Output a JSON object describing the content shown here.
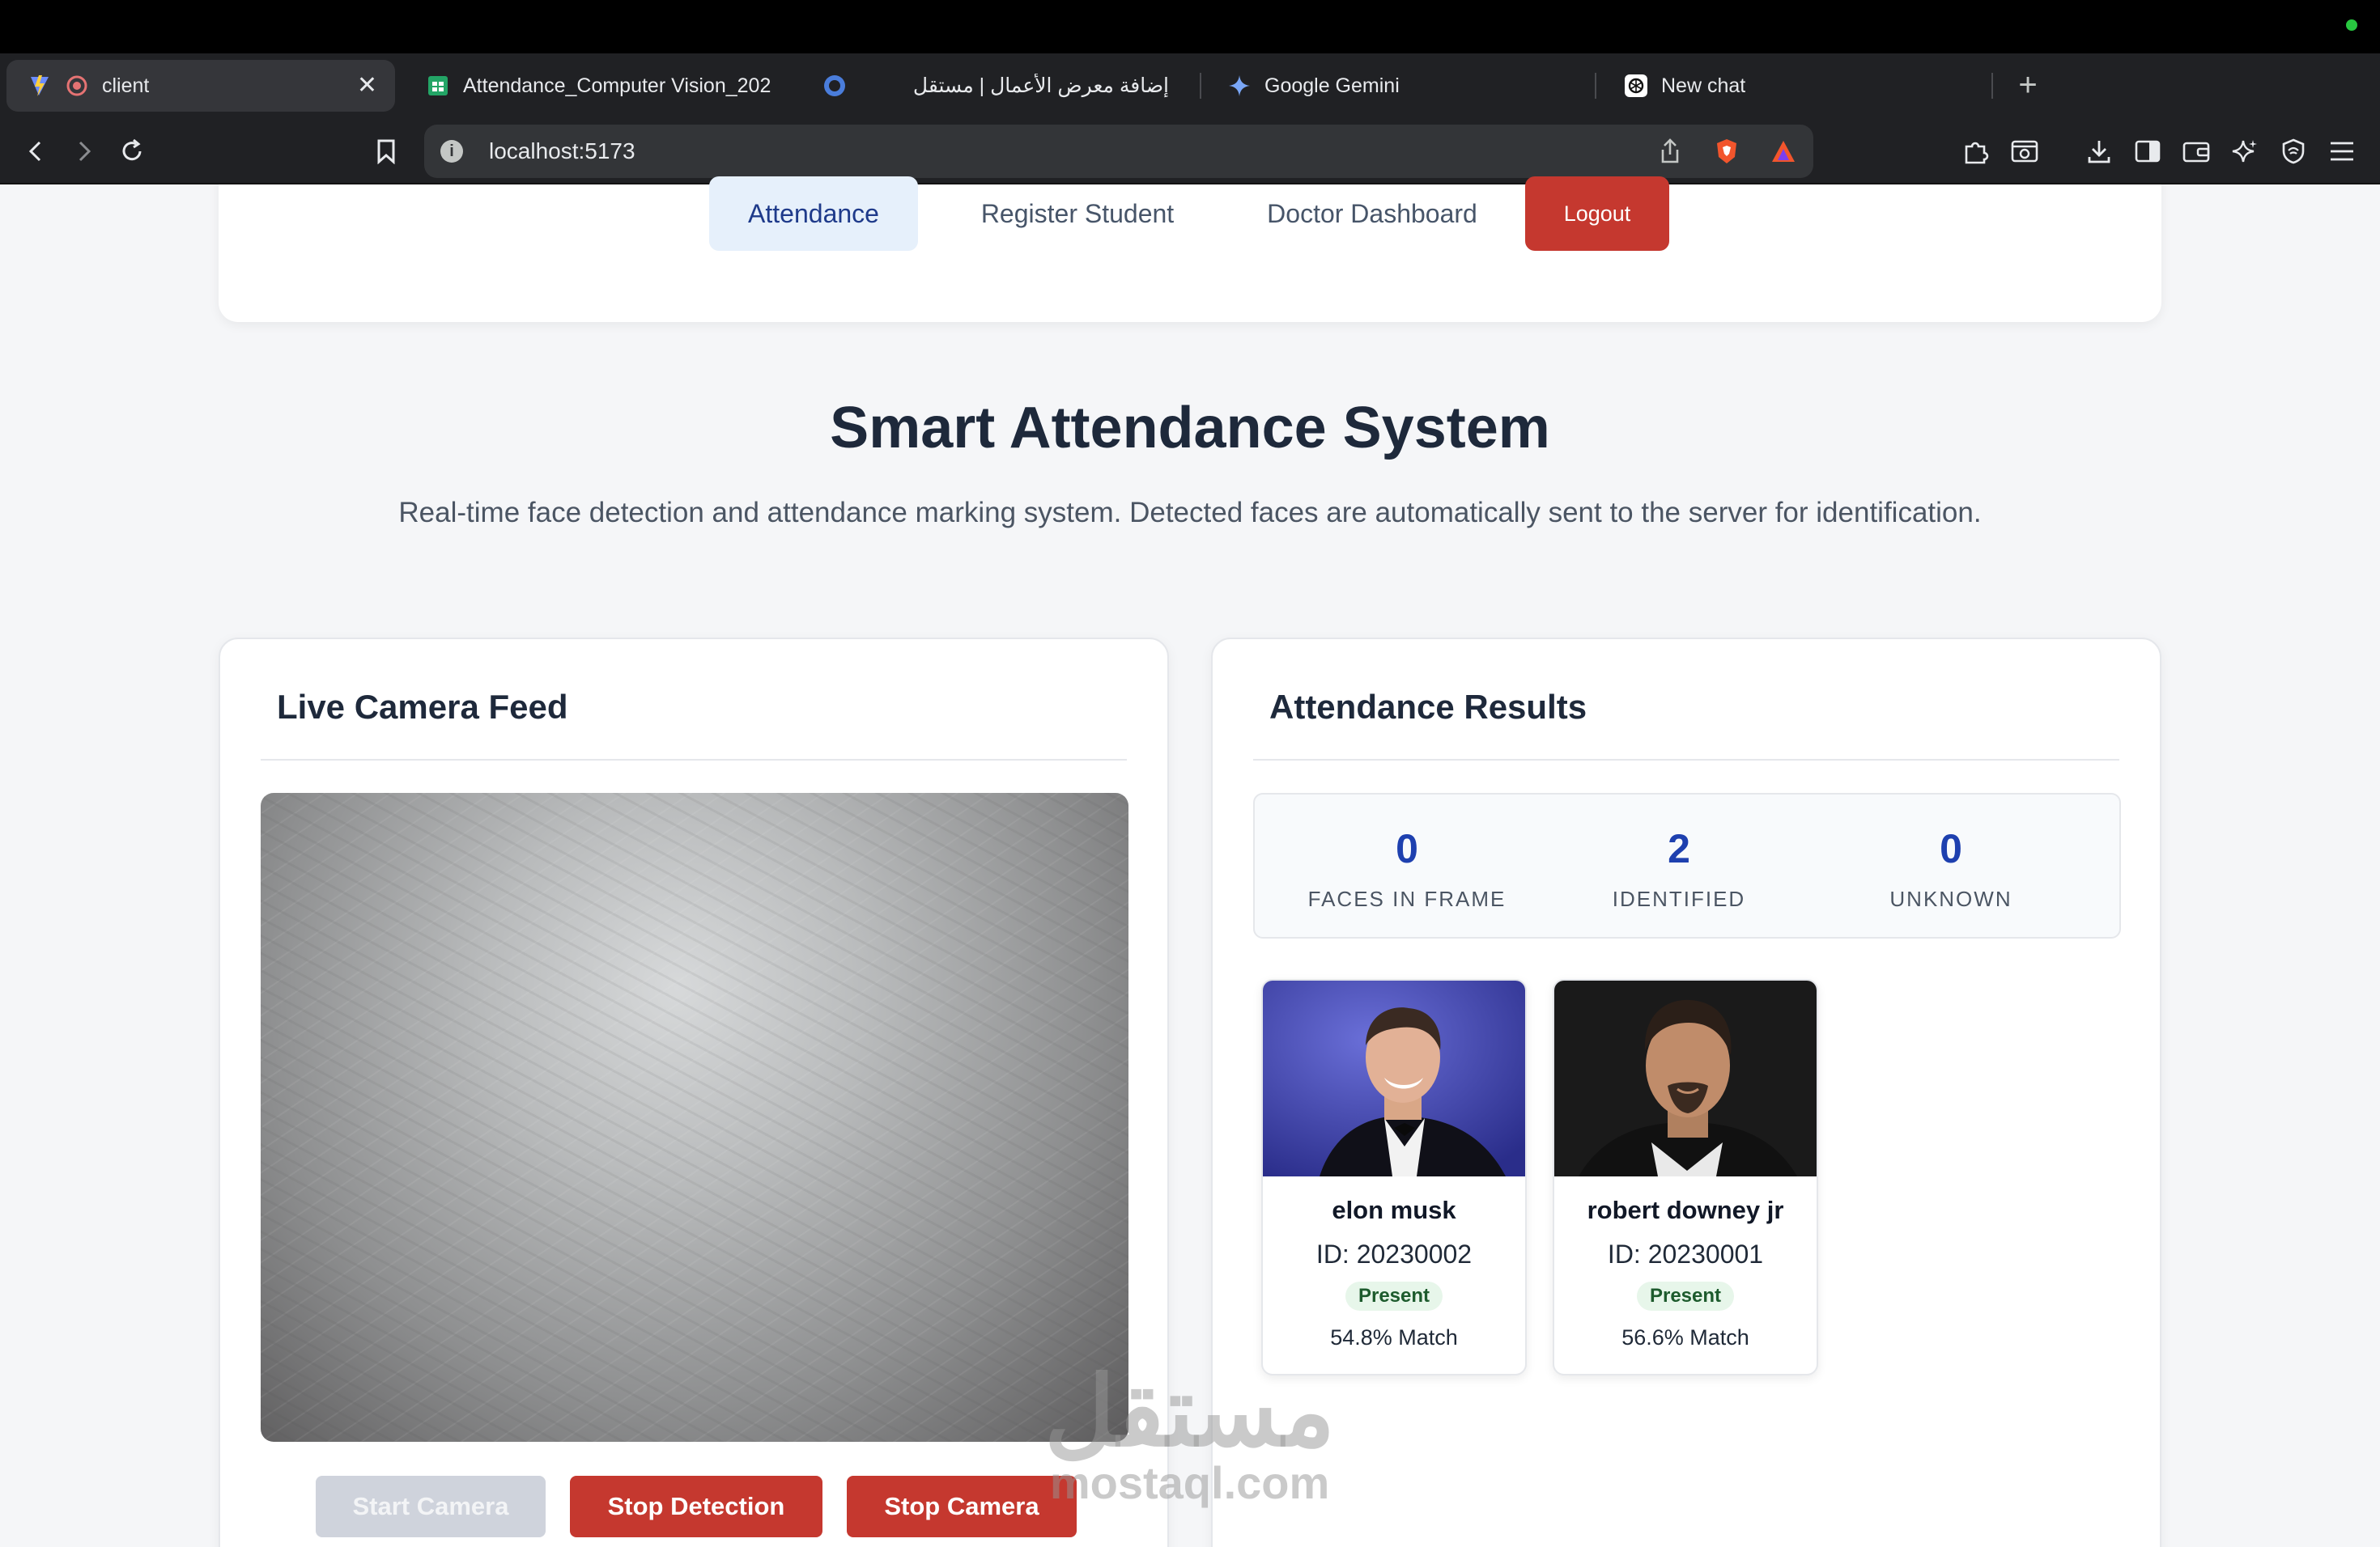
{
  "browser": {
    "tabs": [
      {
        "title": "client",
        "active": true
      },
      {
        "title": "Attendance_Computer Vision_202"
      },
      {
        "title": "إضافة معرض الأعمال | مستقل"
      },
      {
        "title": "Google Gemini"
      },
      {
        "title": "New chat"
      }
    ],
    "close_glyph": "✕",
    "new_tab_glyph": "+",
    "url": "localhost:5173"
  },
  "nav": {
    "items": [
      "Attendance",
      "Register Student",
      "Doctor Dashboard"
    ],
    "logout": "Logout"
  },
  "header": {
    "title": "Smart Attendance System",
    "subtitle": "Real-time face detection and attendance marking system. Detected faces are automatically sent to the server for identification."
  },
  "camera_panel": {
    "title": "Live Camera Feed",
    "buttons": {
      "start": "Start Camera",
      "stop_detection": "Stop Detection",
      "stop_camera": "Stop Camera"
    }
  },
  "results_panel": {
    "title": "Attendance Results",
    "stats": [
      {
        "value": "0",
        "label": "FACES IN FRAME"
      },
      {
        "value": "2",
        "label": "IDENTIFIED"
      },
      {
        "value": "0",
        "label": "UNKNOWN"
      }
    ],
    "students": [
      {
        "name": "elon musk",
        "id": "ID: 20230002",
        "status": "Present",
        "match": "54.8% Match"
      },
      {
        "name": "robert downey jr",
        "id": "ID: 20230001",
        "status": "Present",
        "match": "56.6% Match"
      }
    ]
  },
  "watermark": {
    "arabic": "مستقل",
    "latin": "mostaql.com"
  },
  "colors": {
    "accent": "#1e40af",
    "danger": "#c5382f",
    "present_bg": "#e7f6ea"
  }
}
